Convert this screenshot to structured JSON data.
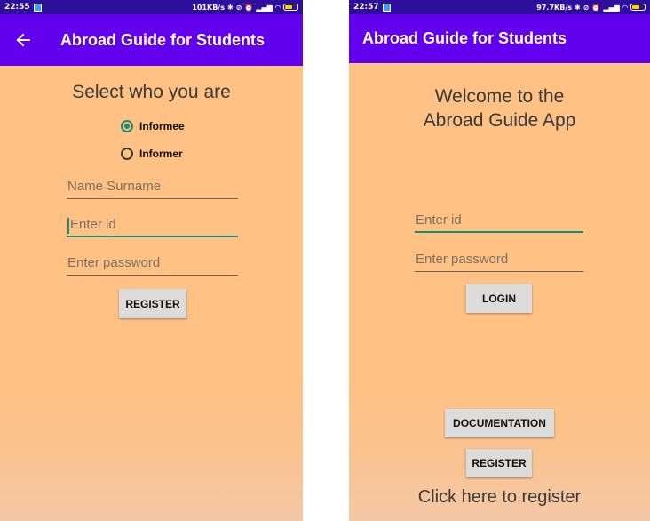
{
  "left_screen": {
    "status_bar": {
      "time": "22:55",
      "network_speed": "101KB/s",
      "icons": [
        "bluetooth-icon",
        "alarm-off-icon",
        "alarm-icon",
        "signal-icon",
        "wifi-icon",
        "battery-icon"
      ]
    },
    "app_bar": {
      "back_icon": "arrow-left-icon",
      "title": "Abroad Guide for Students"
    },
    "heading": "Select who you are",
    "radio_options": [
      {
        "label": "Informee",
        "checked": true
      },
      {
        "label": "Informer",
        "checked": false
      }
    ],
    "fields": {
      "name_placeholder": "Name Surname",
      "id_placeholder": "Enter id",
      "password_placeholder": "Enter password"
    },
    "register_button": "REGISTER"
  },
  "right_screen": {
    "status_bar": {
      "time": "22:57",
      "network_speed": "97.7KB/s",
      "icons": [
        "bluetooth-icon",
        "alarm-off-icon",
        "alarm-icon",
        "signal-icon",
        "wifi-icon",
        "battery-icon"
      ]
    },
    "app_bar": {
      "title": "Abroad Guide for Students"
    },
    "welcome_line1": "Welcome to the",
    "welcome_line2": "Abroad Guide App",
    "fields": {
      "id_placeholder": "Enter id",
      "password_placeholder": "Enter password"
    },
    "login_button": "LOGIN",
    "documentation_button": "DOCUMENTATION",
    "register_button": "REGISTER",
    "footer_text": "Click here to register"
  },
  "colors": {
    "status_bar": "#2e0f9c",
    "app_bar": "#6200ee",
    "background": "#ffc184",
    "accent": "#1f8a70",
    "button": "#dedcda"
  }
}
